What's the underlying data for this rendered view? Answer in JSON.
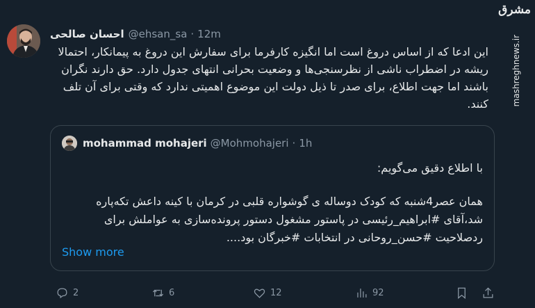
{
  "tweet": {
    "display_name": "احسان صالحی",
    "handle": "@ehsan_sa",
    "time": "12m",
    "text": "این ادعا که از اساس دروغ است اما انگیزه کارفرما برای سفارش این دروغ به پیمانکار، احتمالا ریشه در اضطراب ناشی از نظرسنجی‌ها و وضعیت بحرانی انتهای جدول دارد. حق دارند نگران باشند اما جهت اطلاع، برای صدر تا ذیل دولت این موضوع اهمیتی ندارد که وقتی برای آن تلف کنند."
  },
  "quote": {
    "display_name": "mohammad mohajeri",
    "handle": "@Mohmohajeri",
    "time": "1h",
    "line1": "با اطلاع دقیق می‌گویم:",
    "line2": "همان عصر4شنبه که کودک دوساله ی گوشواره قلبی در کرمان با کینه داعش تکه‌پاره شد،آقای #ابراهیم_رئیسی در پاستور مشغول دستور پرونده‌سازی به عواملش برای ردصلاحیت #حسن_روحانی در انتخابات #خبرگان بود....",
    "show_more": "Show more"
  },
  "actions": {
    "replies": "2",
    "retweets": "6",
    "likes": "12",
    "views": "92"
  },
  "brand": {
    "logo": "مشرق",
    "site": "mashreghnews.ir"
  },
  "icons": {
    "reply": "reply-icon",
    "retweet": "retweet-icon",
    "like": "heart-icon",
    "views": "views-icon",
    "bookmark": "bookmark-icon",
    "share": "share-icon"
  }
}
